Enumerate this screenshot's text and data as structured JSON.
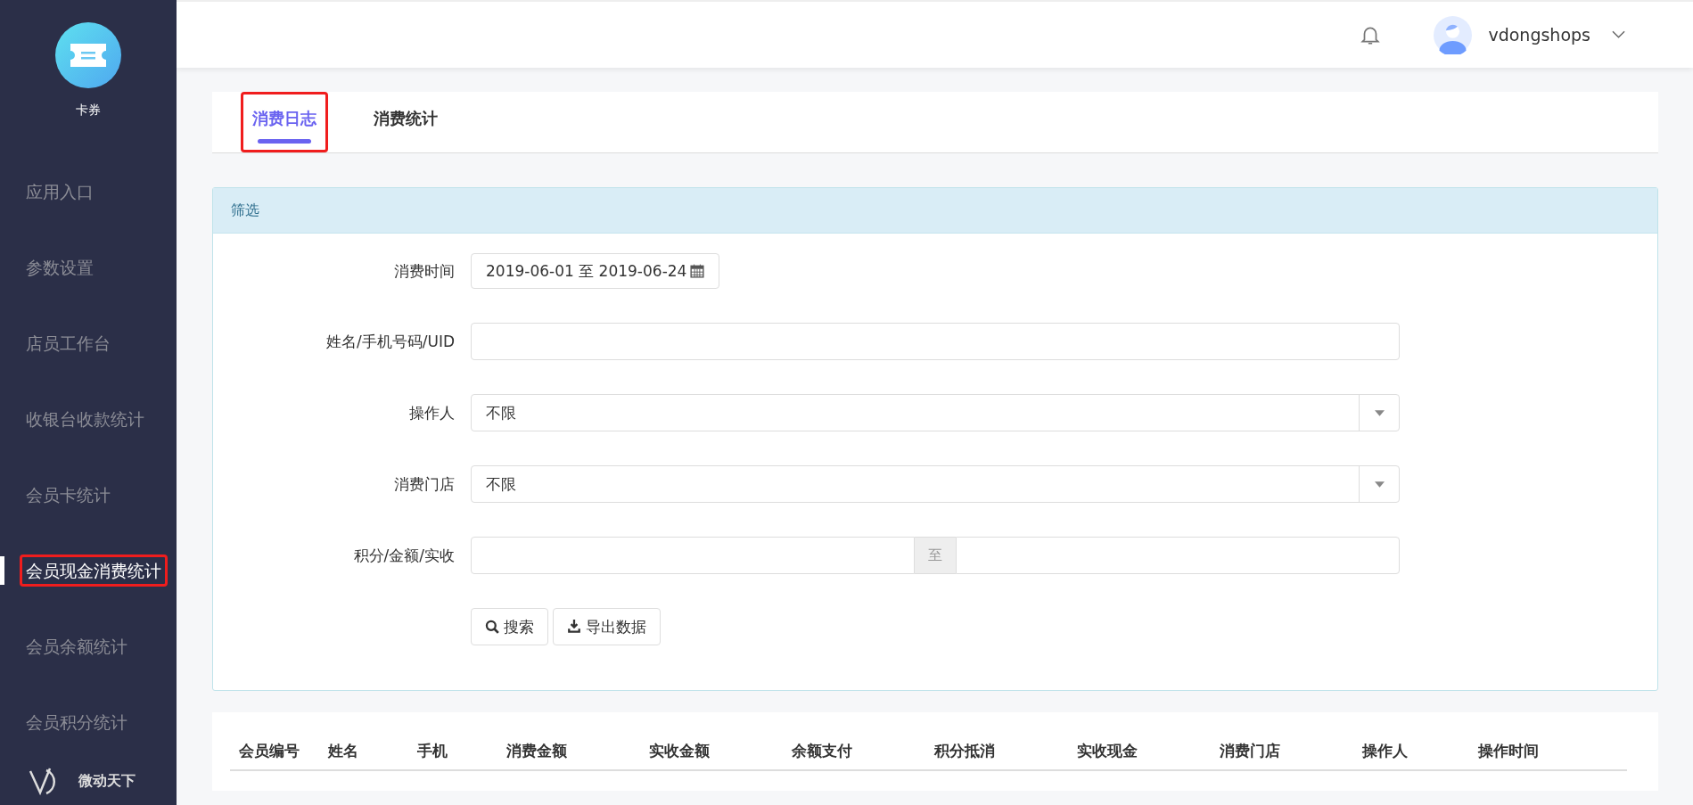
{
  "sidebar": {
    "app": {
      "label": "卡券"
    },
    "items": [
      {
        "label": "应用入口",
        "selected": false,
        "highlighted": false
      },
      {
        "label": "参数设置",
        "selected": false,
        "highlighted": false
      },
      {
        "label": "店员工作台",
        "selected": false,
        "highlighted": false
      },
      {
        "label": "收银台收款统计",
        "selected": false,
        "highlighted": false
      },
      {
        "label": "会员卡统计",
        "selected": false,
        "highlighted": false
      },
      {
        "label": "会员现金消费统计",
        "selected": true,
        "highlighted": true
      },
      {
        "label": "会员余额统计",
        "selected": false,
        "highlighted": false
      },
      {
        "label": "会员积分统计",
        "selected": false,
        "highlighted": false
      }
    ],
    "brand": "微动天下"
  },
  "header": {
    "user": "vdongshops"
  },
  "tabs": [
    {
      "label": "消费日志",
      "selected": true,
      "highlighted": true
    },
    {
      "label": "消费统计",
      "selected": false,
      "highlighted": false
    }
  ],
  "filter": {
    "title": "筛选",
    "fields": [
      {
        "kind": "date",
        "label": "消费时间",
        "value": "2019-06-01 至 2019-06-24"
      },
      {
        "kind": "text",
        "label": "姓名/手机号码/UID"
      },
      {
        "kind": "select",
        "label": "操作人",
        "value": "不限"
      },
      {
        "kind": "select",
        "label": "消费门店",
        "value": "不限"
      },
      {
        "kind": "range",
        "label": "积分/金额/实收",
        "separator": "至"
      }
    ],
    "buttons": [
      {
        "kind": "search",
        "label": "搜索"
      },
      {
        "kind": "export",
        "label": "导出数据"
      }
    ]
  },
  "table": {
    "columns": [
      "会员编号",
      "姓名",
      "手机",
      "消费金额",
      "实收金额",
      "余额支付",
      "积分抵消",
      "实收现金",
      "消费门店",
      "操作人",
      "操作时间"
    ]
  }
}
